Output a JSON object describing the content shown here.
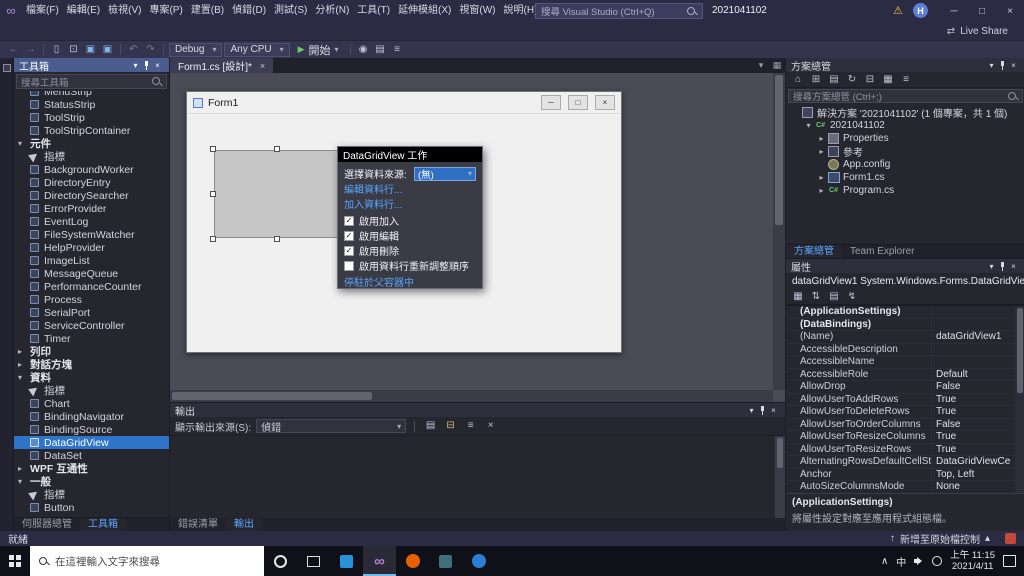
{
  "icons": {
    "minimize": "─",
    "maximize": "□",
    "close": "×",
    "chevron_down": "▾",
    "chevron_right": "▸",
    "chevron_up": "∧",
    "triangle_up": "▴",
    "up_arrow": "↑",
    "back": "←",
    "forward": "→",
    "new_file": "▯",
    "open_file": "⊡",
    "save": "▣",
    "save_all": "▣",
    "undo": "↶",
    "redo": "↷",
    "play": "▶",
    "warning": "⚠",
    "infinity": "∞",
    "menu": "≡",
    "home": "⌂",
    "refresh": "↻",
    "collapse_all": "⊟",
    "expand_all": "⊞",
    "grid": "▤",
    "grid2": "▦",
    "sort_az": "⇅",
    "events": "↯",
    "dots": "⋯"
  },
  "titlebar": {
    "menus": [
      "檔案(F)",
      "編輯(E)",
      "檢視(V)",
      "專案(P)",
      "建置(B)",
      "偵錯(D)",
      "測試(S)",
      "分析(N)",
      "工具(T)",
      "延伸模組(X)",
      "視窗(W)",
      "說明(H)"
    ],
    "search_placeholder": "搜尋 Visual Studio (Ctrl+Q)",
    "window_title": "2021041102",
    "avatar_initial": "H"
  },
  "infobar": {
    "live_share": "Live Share"
  },
  "toolbar": {
    "configuration": "Debug",
    "platform": "Any CPU",
    "start_label": "開始"
  },
  "toolbox": {
    "title": "工具箱",
    "search_placeholder": "搜尋工具箱",
    "items": [
      {
        "label": "MenuStrip",
        "kind": "item"
      },
      {
        "label": "StatusStrip",
        "kind": "item"
      },
      {
        "label": "ToolStrip",
        "kind": "item"
      },
      {
        "label": "ToolStripContainer",
        "kind": "item"
      },
      {
        "label": "元件",
        "kind": "section",
        "expanded": true
      },
      {
        "label": "指標",
        "kind": "pointer"
      },
      {
        "label": "BackgroundWorker",
        "kind": "item"
      },
      {
        "label": "DirectoryEntry",
        "kind": "item"
      },
      {
        "label": "DirectorySearcher",
        "kind": "item"
      },
      {
        "label": "ErrorProvider",
        "kind": "item"
      },
      {
        "label": "EventLog",
        "kind": "item"
      },
      {
        "label": "FileSystemWatcher",
        "kind": "item"
      },
      {
        "label": "HelpProvider",
        "kind": "item"
      },
      {
        "label": "ImageList",
        "kind": "item"
      },
      {
        "label": "MessageQueue",
        "kind": "item"
      },
      {
        "label": "PerformanceCounter",
        "kind": "item"
      },
      {
        "label": "Process",
        "kind": "item"
      },
      {
        "label": "SerialPort",
        "kind": "item"
      },
      {
        "label": "ServiceController",
        "kind": "item"
      },
      {
        "label": "Timer",
        "kind": "item"
      },
      {
        "label": "列印",
        "kind": "section",
        "expanded": false
      },
      {
        "label": "對話方塊",
        "kind": "section",
        "expanded": false
      },
      {
        "label": "資料",
        "kind": "section",
        "expanded": true
      },
      {
        "label": "指標",
        "kind": "pointer"
      },
      {
        "label": "Chart",
        "kind": "item"
      },
      {
        "label": "BindingNavigator",
        "kind": "item"
      },
      {
        "label": "BindingSource",
        "kind": "item"
      },
      {
        "label": "DataGridView",
        "kind": "item",
        "selected": true
      },
      {
        "label": "DataSet",
        "kind": "item"
      },
      {
        "label": "WPF 互通性",
        "kind": "section",
        "expanded": false
      },
      {
        "label": "一般",
        "kind": "section",
        "expanded": true
      },
      {
        "label": "指標",
        "kind": "pointer"
      },
      {
        "label": "Button",
        "kind": "item"
      }
    ],
    "tabs": [
      {
        "label": "伺服器總管",
        "active": false
      },
      {
        "label": "工具箱",
        "active": true
      }
    ]
  },
  "editor": {
    "tab_title": "Form1.cs [設計]*",
    "form_title": "Form1"
  },
  "smart_panel": {
    "title": "DataGridView 工作",
    "data_source_label": "選擇資料來源:",
    "data_source_value": "(無)",
    "links": [
      "編輯資料行...",
      "加入資料行..."
    ],
    "checkboxes": [
      {
        "label": "啟用加入",
        "checked": true
      },
      {
        "label": "啟用編輯",
        "checked": true
      },
      {
        "label": "啟用刪除",
        "checked": true
      },
      {
        "label": "啟用資料行重新調整順序",
        "checked": false
      }
    ],
    "dock_link": "停駐於父容器中"
  },
  "output_panel": {
    "title": "輸出",
    "source_label": "顯示輸出來源(S):",
    "source_value": "偵錯",
    "tabs": [
      {
        "label": "錯誤清單",
        "active": false
      },
      {
        "label": "輸出",
        "active": true
      }
    ]
  },
  "solution_explorer": {
    "title": "方案總管",
    "search_placeholder": "搜尋方案總管 (Ctrl+;)",
    "tree": [
      {
        "label": "解決方案 '2021041102' (1 個專案，共 1 個)",
        "indent": 0,
        "arrow": "",
        "icon": "solution"
      },
      {
        "label": "2021041102",
        "indent": 1,
        "arrow": "expanded",
        "icon": "csharp-project"
      },
      {
        "label": "Properties",
        "indent": 2,
        "arrow": "collapsed",
        "icon": "properties"
      },
      {
        "label": "參考",
        "indent": 2,
        "arrow": "collapsed",
        "icon": "references"
      },
      {
        "label": "App.config",
        "indent": 2,
        "arrow": "",
        "icon": "config"
      },
      {
        "label": "Form1.cs",
        "indent": 2,
        "arrow": "collapsed",
        "icon": "form"
      },
      {
        "label": "Program.cs",
        "indent": 2,
        "arrow": "collapsed",
        "icon": "csharp-file"
      }
    ],
    "tabs": [
      {
        "label": "方案總管",
        "active": true
      },
      {
        "label": "Team Explorer",
        "active": false
      }
    ]
  },
  "properties_panel": {
    "title": "屬性",
    "object_name": "dataGridView1 System.Windows.Forms.DataGridView",
    "rows": [
      {
        "name": "(ApplicationSettings)",
        "value": "",
        "bold": true
      },
      {
        "name": "(DataBindings)",
        "value": "",
        "bold": true
      },
      {
        "name": "(Name)",
        "value": "dataGridView1",
        "bold": false
      },
      {
        "name": "AccessibleDescription",
        "value": "",
        "bold": false
      },
      {
        "name": "AccessibleName",
        "value": "",
        "bold": false
      },
      {
        "name": "AccessibleRole",
        "value": "Default",
        "bold": false
      },
      {
        "name": "AllowDrop",
        "value": "False",
        "bold": false
      },
      {
        "name": "AllowUserToAddRows",
        "value": "True",
        "bold": false
      },
      {
        "name": "AllowUserToDeleteRows",
        "value": "True",
        "bold": false
      },
      {
        "name": "AllowUserToOrderColumns",
        "value": "False",
        "bold": false
      },
      {
        "name": "AllowUserToResizeColumns",
        "value": "True",
        "bold": false
      },
      {
        "name": "AllowUserToResizeRows",
        "value": "True",
        "bold": false
      },
      {
        "name": "AlternatingRowsDefaultCellStyle",
        "value": "DataGridViewCe",
        "bold": false
      },
      {
        "name": "Anchor",
        "value": "Top, Left",
        "bold": false
      },
      {
        "name": "AutoSizeColumnsMode",
        "value": "None",
        "bold": false
      }
    ],
    "description_title": "(ApplicationSettings)",
    "description_text": "將屬性設定對應至應用程式組態檔。"
  },
  "statusbar": {
    "ready": "就緒",
    "source_control": "新增至原始檔控制"
  },
  "taskbar": {
    "search_placeholder": "在這裡輸入文字來搜尋",
    "apps": [
      "cortana",
      "task-view",
      "vscode",
      "visual-studio",
      "firefox",
      "snipping-tool",
      "edge"
    ],
    "active_app": "visual-studio",
    "ime": "中",
    "time": "上午 11:15",
    "date": "2021/4/11"
  },
  "colors": {
    "accent_blue": "#2e74c9",
    "link_blue": "#58a6ff",
    "toolbox_header_blue": "#4a5d8e",
    "titlebar": "#2b2b44",
    "selection": "#2e74c9"
  }
}
